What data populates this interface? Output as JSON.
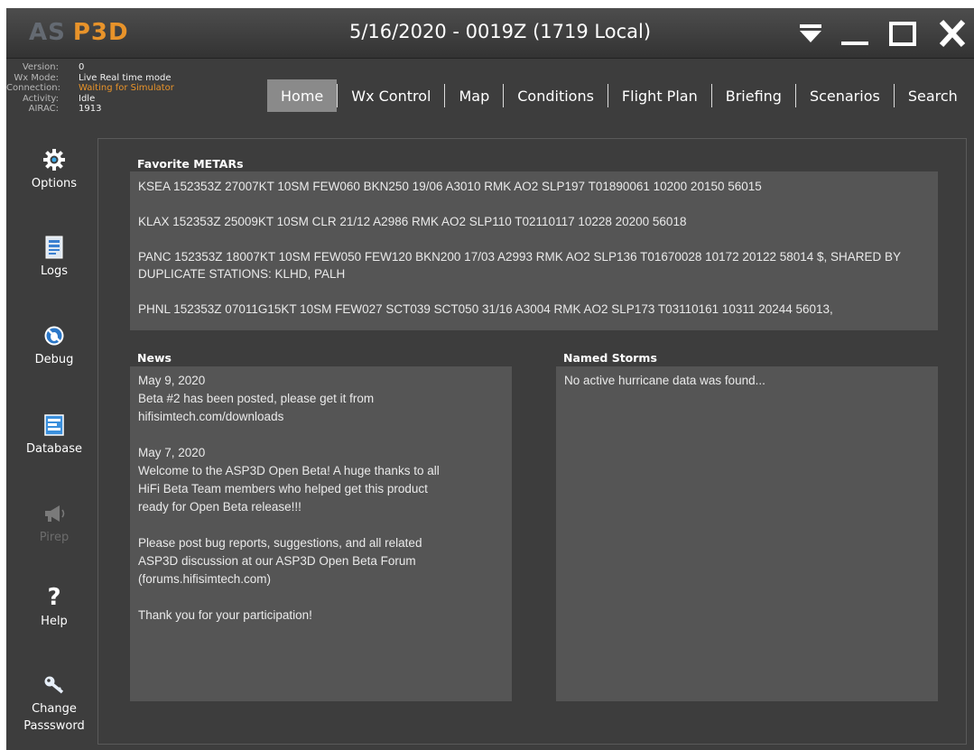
{
  "app": {
    "logo_as": "AS",
    "logo_p3d": "P3D",
    "title": "5/16/2020 - 0019Z (1719 Local)"
  },
  "status": [
    {
      "label": "Version:",
      "value": "0",
      "style": "normal"
    },
    {
      "label": "Wx Mode:",
      "value": "Live Real time mode",
      "style": "normal"
    },
    {
      "label": "Connection:",
      "value": "Waiting for Simulator",
      "style": "warn"
    },
    {
      "label": "Activity:",
      "value": "Idle",
      "style": "normal"
    },
    {
      "label": "AIRAC:",
      "value": "1913",
      "style": "normal"
    }
  ],
  "nav": {
    "tabs": [
      {
        "label": "Home",
        "active": true
      },
      {
        "label": "Wx Control",
        "active": false
      },
      {
        "label": "Map",
        "active": false
      },
      {
        "label": "Conditions",
        "active": false
      },
      {
        "label": "Flight Plan",
        "active": false
      },
      {
        "label": "Briefing",
        "active": false
      },
      {
        "label": "Scenarios",
        "active": false
      },
      {
        "label": "Search",
        "active": false
      }
    ]
  },
  "sidebar": {
    "items": [
      {
        "label": "Options",
        "icon": "gear-icon",
        "enabled": true
      },
      {
        "label": "Logs",
        "icon": "log-file-icon",
        "enabled": true
      },
      {
        "label": "Debug",
        "icon": "debug-icon",
        "enabled": true
      },
      {
        "label": "Database",
        "icon": "database-icon",
        "enabled": true
      },
      {
        "label": "Pirep",
        "icon": "megaphone-icon",
        "enabled": false
      },
      {
        "label": "Help",
        "icon": "question-mark-icon",
        "enabled": true
      },
      {
        "label": "Change Passsword",
        "icon": "key-icon",
        "enabled": true
      }
    ]
  },
  "metars": {
    "title": "Favorite METARs",
    "items": [
      "KSEA 152353Z 27007KT 10SM FEW060 BKN250 19/06 A3010 RMK AO2 SLP197 T01890061 10200 20150 56015",
      "KLAX 152353Z 25009KT 10SM CLR 21/12 A2986 RMK AO2 SLP110 T02110117 10228 20200 56018",
      "PANC 152353Z 18007KT 10SM FEW050 FEW120 BKN200 17/03 A2993 RMK AO2 SLP136 T01670028 10172 20122 58014 $, SHARED BY DUPLICATE STATIONS: KLHD, PALH",
      "PHNL 152353Z 07011G15KT 10SM FEW027 SCT039 SCT050 31/16 A3004 RMK AO2 SLP173 T03110161 10311 20244 56013,"
    ]
  },
  "news": {
    "title": "News",
    "text": "May 9, 2020\nBeta #2 has been posted, please get it from\nhifisimtech.com/downloads\n\nMay 7, 2020\nWelcome to the ASP3D Open Beta!  A huge thanks to all\nHiFi Beta Team members who helped get this product\nready for Open Beta release!!!\n\nPlease post bug reports, suggestions, and all related\nASP3D discussion at our ASP3D Open Beta Forum\n(forums.hifisimtech.com)\n\nThank you for your participation!"
  },
  "storms": {
    "title": "Named Storms",
    "text": "No active hurricane data was found..."
  },
  "colors": {
    "accent": "#e8932a",
    "panel": "#555555",
    "background": "#3d3d3d",
    "active_tab": "#8a8a8a"
  }
}
